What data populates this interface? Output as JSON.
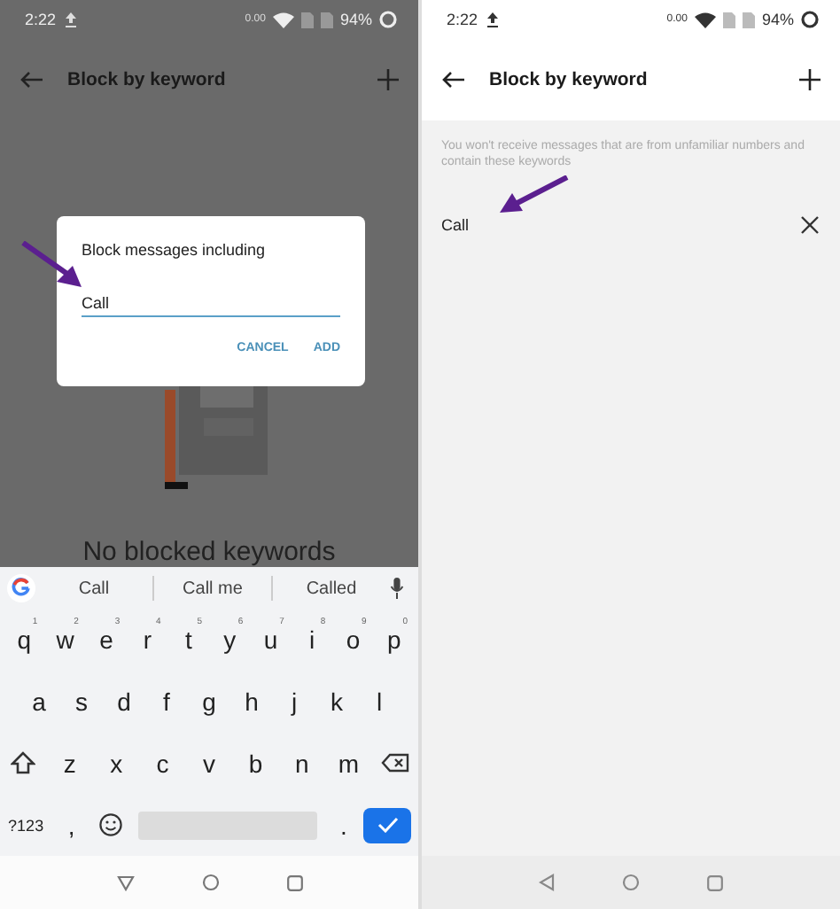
{
  "left_screen": {
    "status_bar": {
      "time": "2:22",
      "speed": "0.00",
      "battery": "94%"
    },
    "app_bar": {
      "title": "Block by keyword"
    },
    "empty_text": "No blocked keywords",
    "dialog": {
      "title": "Block messages including",
      "value": "Call",
      "buttons": [
        "CANCEL",
        "ADD"
      ]
    },
    "keyboard": {
      "suggestions": [
        "Call",
        "Call me",
        "Called"
      ],
      "rows": [
        [
          {
            "kind": "letter",
            "label": "q",
            "hint": "1"
          },
          {
            "kind": "letter",
            "label": "w",
            "hint": "2"
          },
          {
            "kind": "letter",
            "label": "e",
            "hint": "3"
          },
          {
            "kind": "letter",
            "label": "r",
            "hint": "4"
          },
          {
            "kind": "letter",
            "label": "t",
            "hint": "5"
          },
          {
            "kind": "letter",
            "label": "y",
            "hint": "6"
          },
          {
            "kind": "letter",
            "label": "u",
            "hint": "7"
          },
          {
            "kind": "letter",
            "label": "i",
            "hint": "8"
          },
          {
            "kind": "letter",
            "label": "o",
            "hint": "9"
          },
          {
            "kind": "letter",
            "label": "p",
            "hint": "0"
          }
        ],
        [
          {
            "kind": "letter",
            "label": "a"
          },
          {
            "kind": "letter",
            "label": "s"
          },
          {
            "kind": "letter",
            "label": "d"
          },
          {
            "kind": "letter",
            "label": "f"
          },
          {
            "kind": "letter",
            "label": "g"
          },
          {
            "kind": "letter",
            "label": "h"
          },
          {
            "kind": "letter",
            "label": "j"
          },
          {
            "kind": "letter",
            "label": "k"
          },
          {
            "kind": "letter",
            "label": "l"
          }
        ],
        [
          {
            "kind": "shift"
          },
          {
            "kind": "letter",
            "label": "z"
          },
          {
            "kind": "letter",
            "label": "x"
          },
          {
            "kind": "letter",
            "label": "c"
          },
          {
            "kind": "letter",
            "label": "v"
          },
          {
            "kind": "letter",
            "label": "b"
          },
          {
            "kind": "letter",
            "label": "n"
          },
          {
            "kind": "letter",
            "label": "m"
          },
          {
            "kind": "backspace"
          }
        ],
        [
          {
            "kind": "symbols",
            "label": "?123"
          },
          {
            "kind": "letter",
            "label": ","
          },
          {
            "kind": "emoji"
          },
          {
            "kind": "space"
          },
          {
            "kind": "letter",
            "label": "."
          },
          {
            "kind": "enter"
          }
        ]
      ]
    }
  },
  "right_screen": {
    "status_bar": {
      "time": "2:22",
      "speed": "0.00",
      "battery": "94%"
    },
    "app_bar": {
      "title": "Block by keyword"
    },
    "description": "You won't receive messages that are from unfamiliar numbers and contain these keywords",
    "keywords": [
      {
        "text": "Call"
      }
    ]
  }
}
